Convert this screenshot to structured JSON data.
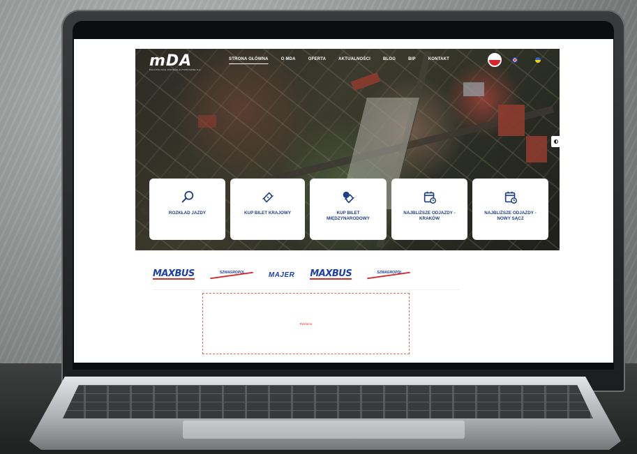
{
  "site": {
    "logo": {
      "text": "mDA",
      "subtitle": "MAŁOPOLSKIE DWORCE AUTOBUSOWE S.A."
    },
    "nav": {
      "items": [
        {
          "label": "STRONA GŁÓWNA",
          "active": true
        },
        {
          "label": "O MDA"
        },
        {
          "label": "OFERTA"
        },
        {
          "label": "AKTUALNOŚCI"
        },
        {
          "label": "BLOG"
        },
        {
          "label": "BIP"
        },
        {
          "label": "KONTAKT"
        }
      ]
    },
    "languages": [
      "pl-flag-icon",
      "en-flag-icon",
      "ua-flag-icon"
    ],
    "tiles": [
      {
        "label": "ROZKŁAD JAZDY",
        "icon": "search-icon"
      },
      {
        "label": "KUP BILET KRAJOWY",
        "icon": "ticket-icon"
      },
      {
        "label": "KUP BILET MIĘDZYNARODOWY",
        "icon": "globe-ticket-icon"
      },
      {
        "label": "NAJBLIŻSZE ODJAZDY - KRAKÓW",
        "icon": "calendar-clock-icon"
      },
      {
        "label": "NAJBLIŻSZE ODJAZDY - NOWY SĄCZ",
        "icon": "calendar-clock-icon"
      }
    ],
    "partners": [
      "MAXBUS",
      "SZWAGROPOL",
      "MAJER",
      "MAXBUS",
      "SZWAGROPOL"
    ],
    "ad": {
      "label": "Reklama"
    },
    "colors": {
      "accent": "#1d3f86",
      "partner_red": "#d52b2b",
      "ad_border": "#e36a5f"
    }
  }
}
